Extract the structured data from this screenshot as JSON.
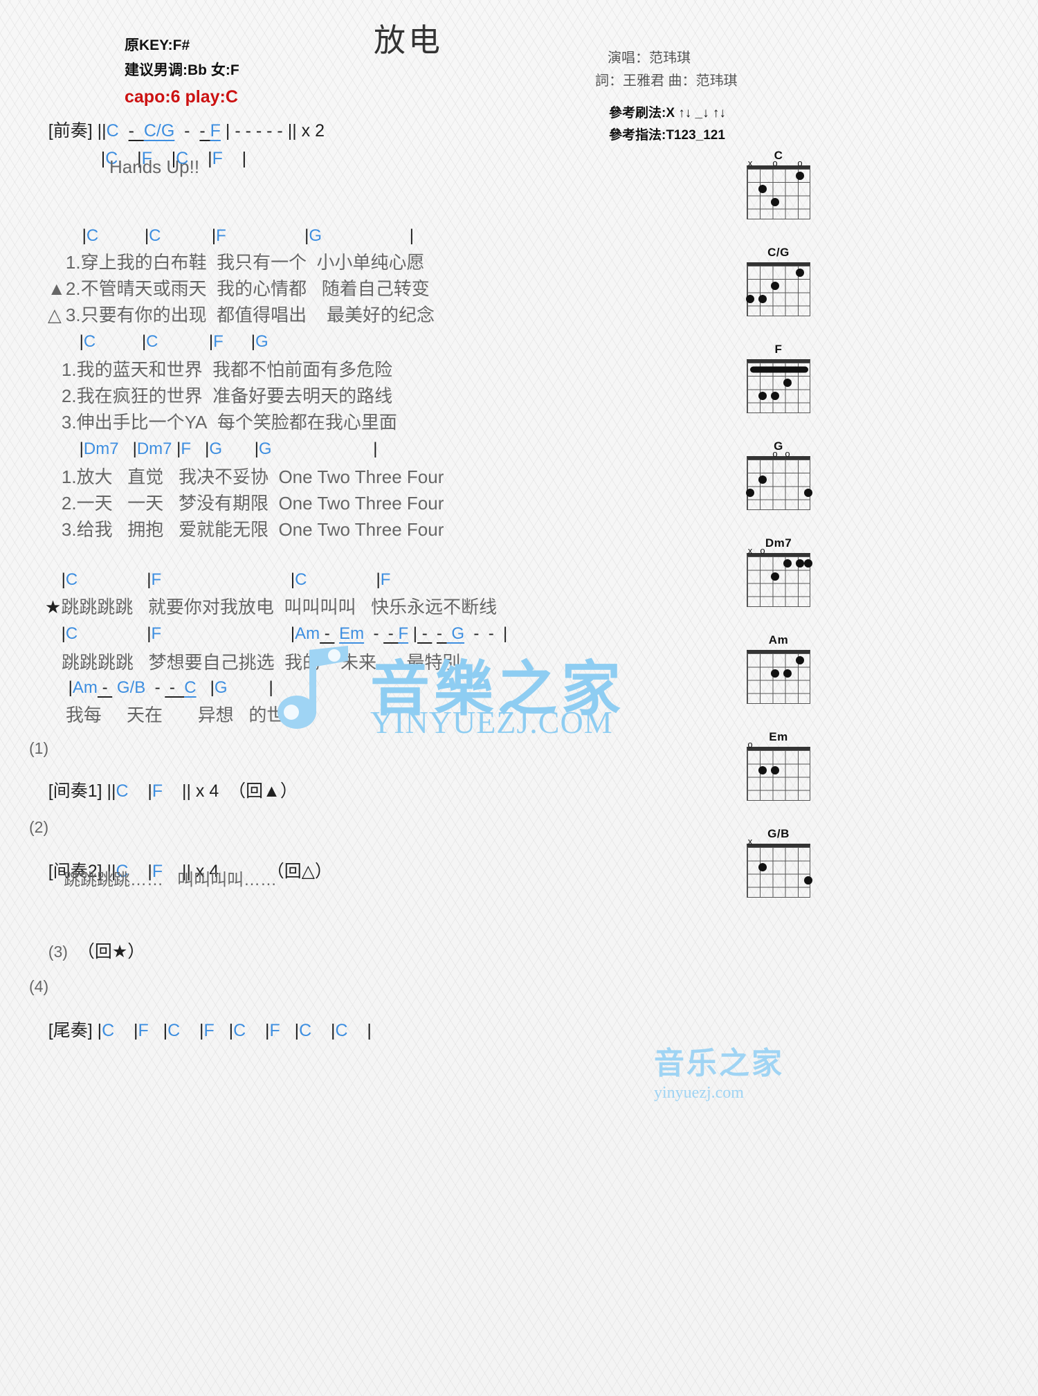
{
  "header": {
    "title": "放电",
    "orig_key": "原KEY:F#",
    "suggest_key": "建议男调:Bb 女:F",
    "capo": "capo:6 play:C",
    "singer": "演唱：范玮琪",
    "writers": "詞：王雅君   曲：范玮琪",
    "strum_ref": "參考刷法:X ↑↓ _↓ ↑↓",
    "finger_ref": "參考指法:T123_121"
  },
  "intro": {
    "label": "[前奏]",
    "line1_bars": "||",
    "line1": "C  -  C/G  -  -  F | -  -  -  -  -  || x 2",
    "line2": "|C     |F     |C     |F     |",
    "hands_up": "Hands Up!!"
  },
  "verse1": {
    "chords": "|C            |C            |F                  |G                       |",
    "chord_tokens": [
      "|C",
      "|C",
      "|F",
      "|G",
      "|"
    ],
    "lines": [
      {
        "mark": "",
        "num": "1.",
        "a": "穿上我的白布鞋",
        "b": "我只有一个",
        "c": "小小单纯心愿"
      },
      {
        "mark": "▲",
        "num": "2.",
        "a": "不管晴天或雨天",
        "b": "我的心情都",
        "c": "随着自己转变"
      },
      {
        "mark": "△",
        "num": "3.",
        "a": "只要有你的出现",
        "b": "都值得唱出",
        "c": "最美好的纪念"
      }
    ]
  },
  "verse2": {
    "chord_tokens": [
      "|C",
      "|C",
      "|F",
      "|G"
    ],
    "lines": [
      {
        "num": "1.",
        "a": "我的蓝天和世界",
        "b": "我都不怕前面有多危险"
      },
      {
        "num": "2.",
        "a": "我在疯狂的世界",
        "b": "准备好要去明天的路线"
      },
      {
        "num": "3.",
        "a": "伸出手比一个YA",
        "b": "每个笑脸都在我心里面"
      }
    ]
  },
  "verse3": {
    "chord_tokens": [
      "|Dm7",
      "|Dm7",
      "|F",
      "|G",
      "|G",
      "|"
    ],
    "lines": [
      {
        "num": "1.",
        "a": "放大",
        "b": "直觉",
        "c": "我决不妥协",
        "d": "One Two Three Four"
      },
      {
        "num": "2.",
        "a": "一天",
        "b": "一天",
        "c": "梦没有期限",
        "d": "One Two Three Four"
      },
      {
        "num": "3.",
        "a": "给我",
        "b": "拥抱",
        "c": "爱就能无限",
        "d": "One Two Three Four"
      }
    ]
  },
  "chorus": {
    "line1_chords": [
      "|C",
      "|F",
      "|C",
      "|F"
    ],
    "line1_mark": "★",
    "line1": {
      "a": "跳跳跳跳",
      "b": "就要你对我放电",
      "c": "叫叫叫叫",
      "d": "快乐永远不断线"
    },
    "line2_chords": [
      "|C",
      "|F",
      "|Am",
      "-",
      "Em",
      "-",
      "-",
      "F",
      "|",
      "-",
      "-",
      "G",
      "-",
      "-",
      "|"
    ],
    "line2_chord_text": "|Am  -  Em   -  - F | -   -   G  -  - |",
    "line2": {
      "a": "跳跳跳跳",
      "b": "梦想要自己挑选",
      "c": "我的",
      "d": "未来",
      "e": "最特别"
    },
    "line3_chord_text": "|Am  -  G/B  -  -  C   |G       |",
    "line3": {
      "a": "我每",
      "b": "天在",
      "c": "异想",
      "d": "的世界"
    }
  },
  "sections": [
    {
      "num": "(1)",
      "label": "[间奏1]",
      "chords": "||C    |F    || x 4",
      "repeat": "（回▲）",
      "sub": ""
    },
    {
      "num": "(2)",
      "label": "[间奏2]",
      "chords": "||C    |F    || x 4",
      "repeat": "（回△）",
      "sub": "跳跳跳跳……   叫叫叫叫……"
    },
    {
      "num": "(3)",
      "label": "",
      "chords": "",
      "repeat": "（回★）",
      "sub": ""
    },
    {
      "num": "(4)",
      "label": "[尾奏]",
      "chords": "|C    |F   |C    |F   |C    |F   |C    |C    |",
      "repeat": "",
      "sub": ""
    }
  ],
  "diagrams": [
    {
      "name": "C",
      "markers": "x o   o",
      "dots": [
        [
          5,
          1
        ],
        [
          4,
          2
        ],
        [
          2,
          3
        ]
      ],
      "open": [
        3,
        1
      ],
      "mute": [
        6
      ],
      "barre": null
    },
    {
      "name": "C/G",
      "markers": "",
      "dots": [
        [
          6,
          3
        ],
        [
          5,
          3
        ],
        [
          4,
          2
        ],
        [
          2,
          1
        ]
      ],
      "open": [
        3,
        1
      ],
      "mute": [],
      "barre": null
    },
    {
      "name": "F",
      "markers": "",
      "dots": [
        [
          5,
          3
        ],
        [
          4,
          3
        ],
        [
          3,
          2
        ]
      ],
      "open": [],
      "mute": [],
      "barre": {
        "fret": 1,
        "from": 1,
        "to": 6
      }
    },
    {
      "name": "G",
      "markers": "",
      "dots": [
        [
          6,
          3
        ],
        [
          5,
          2
        ],
        [
          1,
          3
        ]
      ],
      "open": [
        4,
        3,
        2
      ],
      "mute": [],
      "barre": null
    },
    {
      "name": "Dm7",
      "markers": "x o",
      "dots": [
        [
          4,
          2
        ],
        [
          3,
          2
        ],
        [
          2,
          1
        ],
        [
          1,
          1
        ]
      ],
      "open": [
        5
      ],
      "mute": [
        6
      ],
      "barre": null
    },
    {
      "name": "Am",
      "markers": "x o",
      "dots": [
        [
          4,
          2
        ],
        [
          3,
          2
        ],
        [
          2,
          1
        ]
      ],
      "open": [
        5,
        1
      ],
      "mute": [
        6
      ],
      "barre": null
    },
    {
      "name": "Em",
      "markers": "o",
      "dots": [
        [
          5,
          2
        ],
        [
          4,
          2
        ]
      ],
      "open": [
        6,
        3,
        2,
        1
      ],
      "mute": [],
      "barre": null
    },
    {
      "name": "G/B",
      "markers": "x",
      "dots": [
        [
          5,
          2
        ],
        [
          1,
          3
        ]
      ],
      "open": [
        4,
        3
      ],
      "mute": [
        6
      ],
      "barre": null
    }
  ],
  "watermark": {
    "center_cn": "音樂之家",
    "center_en": "YINYUEZJ.COM",
    "corner_cn": "音乐之家",
    "corner_en": "yinyuezj.com"
  }
}
